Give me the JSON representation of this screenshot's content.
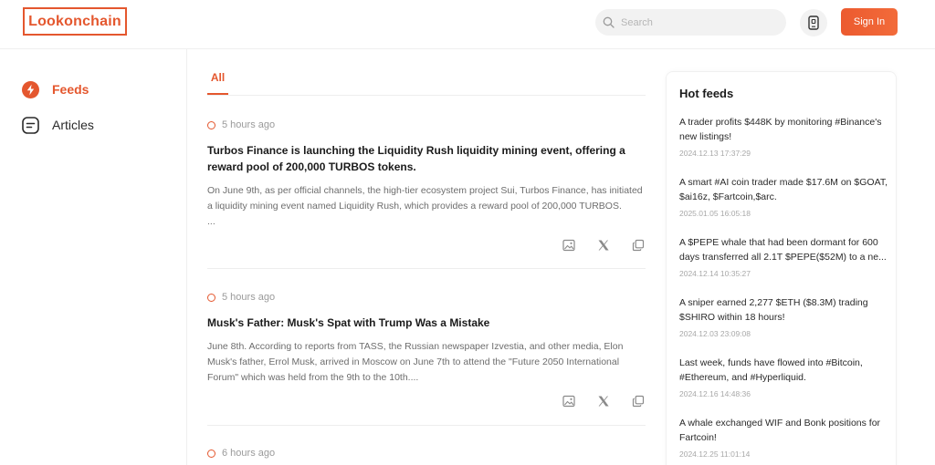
{
  "header": {
    "logo": "Lookonchain",
    "search_placeholder": "Search",
    "signin_label": "Sign In"
  },
  "sidebar": {
    "items": [
      {
        "label": "Feeds",
        "icon": "lightning-icon",
        "active": true
      },
      {
        "label": "Articles",
        "icon": "article-icon",
        "active": false
      }
    ]
  },
  "main": {
    "tabs": [
      {
        "label": "All",
        "active": true
      }
    ],
    "posts": [
      {
        "time": "5 hours ago",
        "title": "Turbos Finance is launching the Liquidity Rush liquidity mining event, offering a reward pool of 200,000 TURBOS tokens.",
        "body": "On June 9th, as per official channels, the high-tier ecosystem project Sui, Turbos Finance, has initiated a liquidity mining event named Liquidity Rush, which provides a reward pool of 200,000 TURBOS.",
        "ellipsis": "..."
      },
      {
        "time": "5 hours ago",
        "title": "Musk's Father: Musk's Spat with Trump Was a Mistake",
        "body": "June 8th. According to reports from TASS, the Russian newspaper Izvestia, and other media, Elon Musk's father, Errol Musk, arrived in Moscow on June 7th to attend the \"Future 2050 International Forum\" which was held from the 9th to the 10th...."
      },
      {
        "time": "6 hours ago"
      }
    ]
  },
  "hot_feeds": {
    "title": "Hot feeds",
    "items": [
      {
        "text": "A trader profits $448K by monitoring #Binance's new listings!",
        "date": "2024.12.13 17:37:29"
      },
      {
        "text": "A smart #AI coin trader made $17.6M on $GOAT, $ai16z, $Fartcoin,$arc.",
        "date": "2025.01.05 16:05:18"
      },
      {
        "text": "A $PEPE whale that had been dormant for 600 days transferred all 2.1T $PEPE($52M) to a ne...",
        "date": "2024.12.14 10:35:27"
      },
      {
        "text": "A sniper earned 2,277 $ETH ($8.3M) trading $SHIRO within 18 hours!",
        "date": "2024.12.03 23:09:08"
      },
      {
        "text": "Last week, funds have flowed into #Bitcoin, #Ethereum, and #Hyperliquid.",
        "date": "2024.12.16 14:48:36"
      },
      {
        "text": "A whale exchanged WIF and Bonk positions for Fartcoin!",
        "date": "2024.12.25 11:01:14"
      }
    ]
  },
  "colors": {
    "accent": "#e4572e",
    "muted_text": "#9a9a9a",
    "body_text": "#6d6d6d"
  }
}
